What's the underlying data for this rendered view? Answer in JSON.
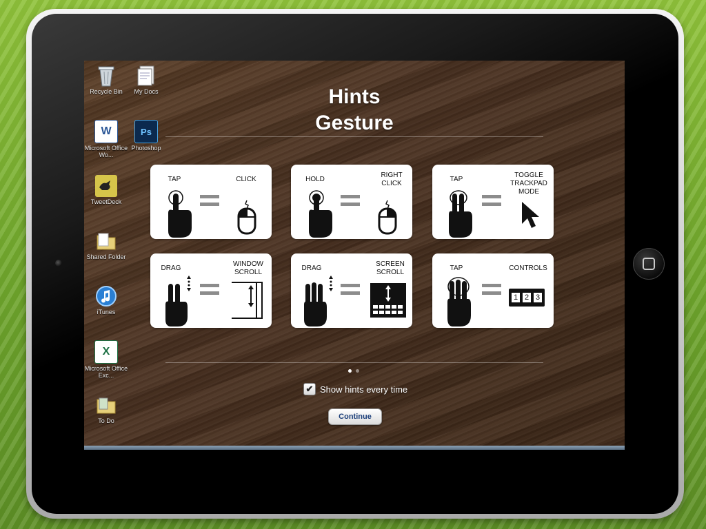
{
  "title": {
    "line1": "Hints",
    "line2": "Gesture"
  },
  "desktop_icons": [
    {
      "label": "Recycle Bin",
      "icon": "recycle-bin-icon"
    },
    {
      "label": "My Docs",
      "icon": "documents-icon"
    },
    {
      "label": "Microsoft Office Wo...",
      "icon": "word-icon"
    },
    {
      "label": "Photoshop",
      "icon": "photoshop-icon",
      "glyph": "Ps"
    },
    {
      "label": "TweetDeck",
      "icon": "tweetdeck-icon"
    },
    {
      "label": "Shared Folder",
      "icon": "folder-icon"
    },
    {
      "label": "iTunes",
      "icon": "itunes-icon"
    },
    {
      "label": "Microsoft Office Exc...",
      "icon": "excel-icon"
    },
    {
      "label": "To Do",
      "icon": "folder-icon"
    }
  ],
  "hint_cards": [
    {
      "gesture": "TAP",
      "result": "CLICK",
      "gesture_icon": "one-finger-tap-icon",
      "result_icon": "mouse-left-click-icon"
    },
    {
      "gesture": "HOLD",
      "result": "RIGHT CLICK",
      "gesture_icon": "one-finger-hold-icon",
      "result_icon": "mouse-right-click-icon"
    },
    {
      "gesture": "TAP",
      "result": "TOGGLE TRACKPAD MODE",
      "gesture_icon": "two-finger-tap-icon",
      "result_icon": "cursor-arrow-icon"
    },
    {
      "gesture": "DRAG",
      "result": "WINDOW SCROLL",
      "gesture_icon": "two-finger-drag-icon",
      "result_icon": "window-scroll-icon"
    },
    {
      "gesture": "DRAG",
      "result": "SCREEN SCROLL",
      "gesture_icon": "three-finger-drag-icon",
      "result_icon": "screen-scroll-icon"
    },
    {
      "gesture": "TAP",
      "result": "CONTROLS",
      "gesture_icon": "three-finger-tap-icon",
      "result_icon": "controls-keys-icon",
      "keys": [
        "1",
        "2",
        "3"
      ]
    }
  ],
  "pagination": {
    "pages": 2,
    "current": 1
  },
  "show_hints": {
    "label": "Show hints every time",
    "checked": true,
    "check_glyph": "✔"
  },
  "continue_button": {
    "label": "Continue"
  },
  "colors": {
    "card_bg": "#ffffff",
    "equals_gray": "#8c8c8c",
    "continue_text": "#1c3f7a",
    "wood_dark": "#3e2818"
  }
}
